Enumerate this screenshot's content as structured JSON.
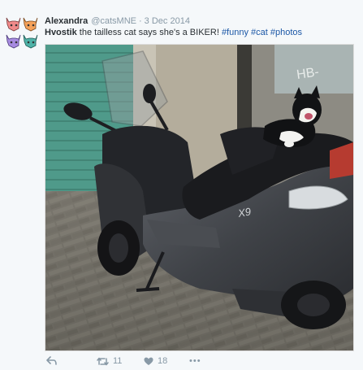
{
  "tweet": {
    "fullname": "Alexandra",
    "handle": "@catsMNE",
    "separator": "·",
    "date": "3 Dec 2014",
    "mention": "Hvostik",
    "text_body": " the tailless cat says she's a BIKER! ",
    "hashtags": [
      "#funny",
      "#cat",
      "#photos"
    ]
  },
  "actions": {
    "retweet_count": "11",
    "like_count": "18",
    "more_label": "•••"
  },
  "media": {
    "scooter_badge": "X9",
    "wall_graffiti": "HB-"
  },
  "colors": {
    "hashtag": "#1b57a6",
    "meta_grey": "#8899a6",
    "shutter_teal": "#4f9a8a"
  },
  "icons": [
    "avatar-cats-icon",
    "reply-icon",
    "retweet-icon",
    "heart-icon",
    "more-icon"
  ]
}
